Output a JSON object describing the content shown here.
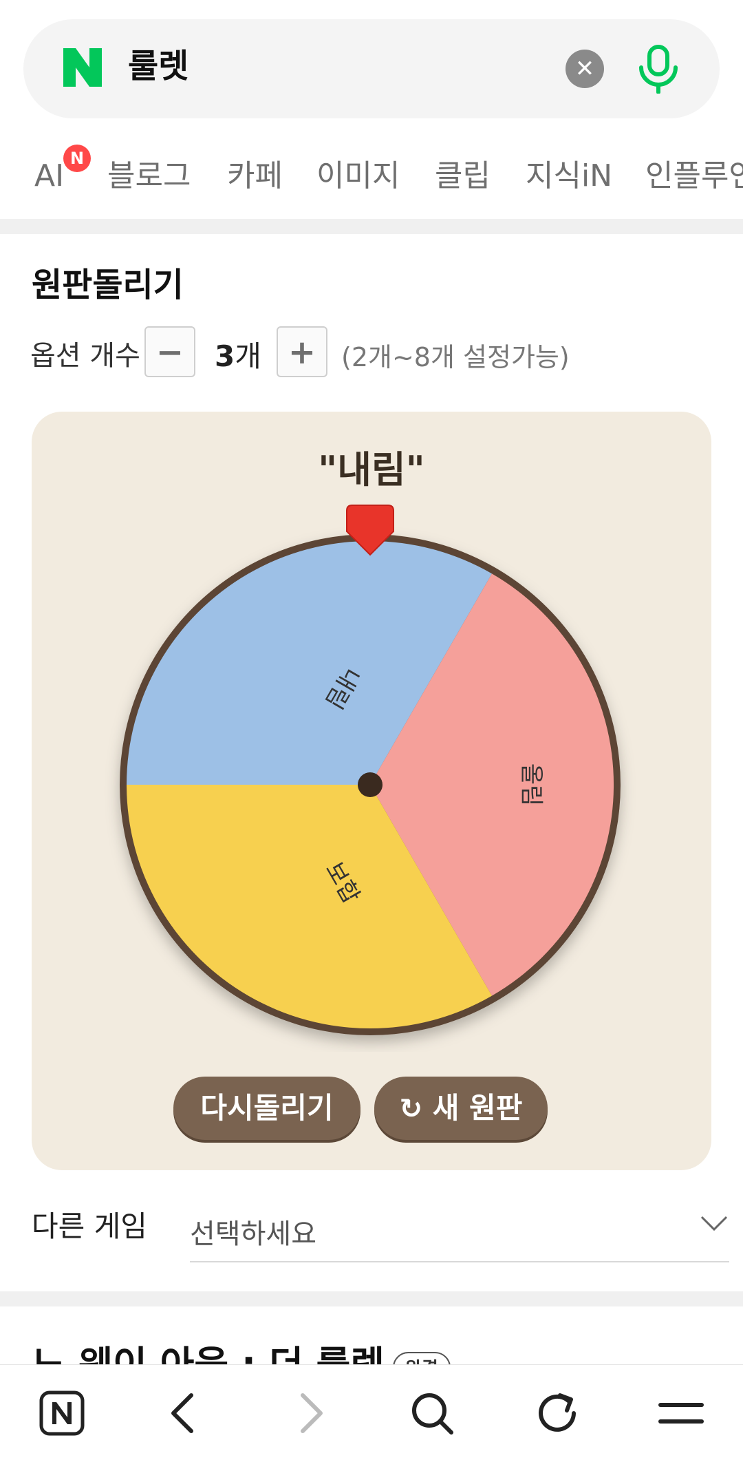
{
  "search": {
    "query": "룰렛",
    "logo_icon": "naver-n-logo",
    "clear_icon": "close-icon",
    "mic_icon": "microphone-icon",
    "brand_color": "#03c75a"
  },
  "tabs": [
    {
      "label": "AI",
      "badge": "N"
    },
    {
      "label": "블로그"
    },
    {
      "label": "카페"
    },
    {
      "label": "이미지"
    },
    {
      "label": "클립"
    },
    {
      "label": "지식iN"
    },
    {
      "label": "인플루언"
    }
  ],
  "roulette": {
    "title": "원판돌리기",
    "option_label": "옵션 개수",
    "minus_label": "−",
    "plus_label": "+",
    "count_value": "3",
    "count_unit": "개",
    "range_note": "(2개~8개 설정가능)",
    "result": "\"내림\"",
    "segments": [
      {
        "label": "내림",
        "color": "#9dc0e6"
      },
      {
        "label": "올림",
        "color": "#f5a09a"
      },
      {
        "label": "보합",
        "color": "#f7d04f"
      }
    ],
    "spin_again": "다시돌리기",
    "new_wheel": "새 원판",
    "new_wheel_icon": "refresh-icon"
  },
  "other_games": {
    "label": "다른 게임",
    "select_value": "선택하세요"
  },
  "next_card": {
    "title": "노 웨이 아웃 : 더 룰렛",
    "badge": "완결"
  },
  "bottom_nav": {
    "icons": [
      "naver-home-icon",
      "back-icon",
      "forward-icon",
      "search-icon",
      "refresh-icon",
      "menu-icon"
    ]
  }
}
